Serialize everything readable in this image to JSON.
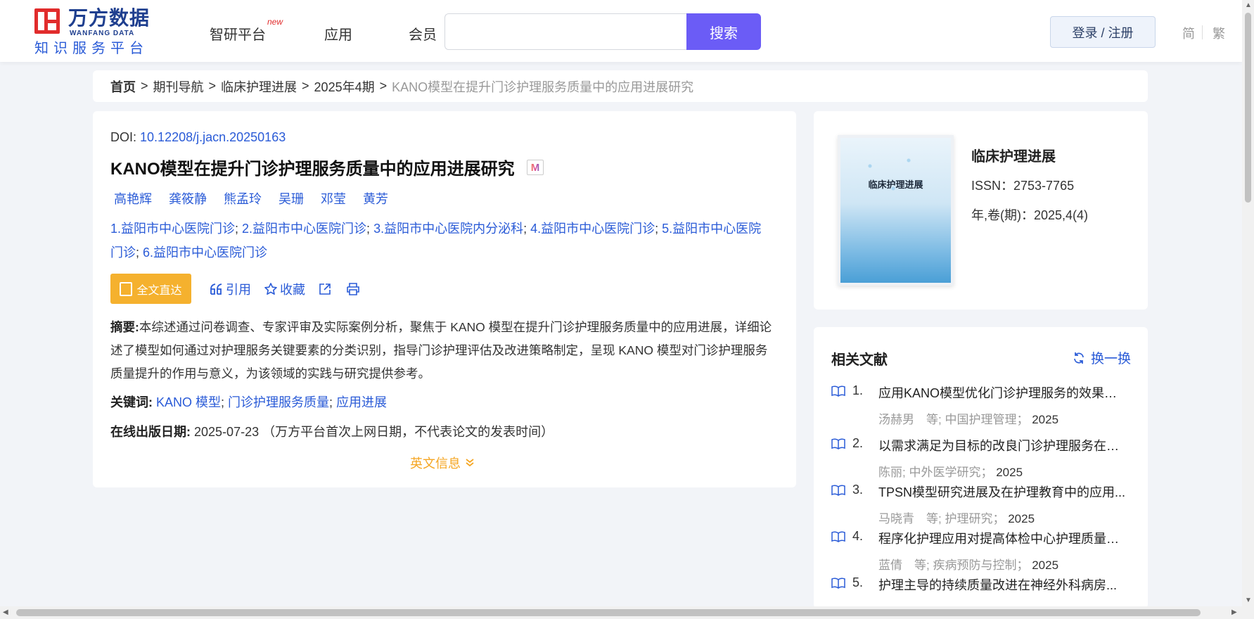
{
  "header": {
    "logo_cn": "万方数据",
    "logo_en": "WANFANG DATA",
    "logo_sub": "知识服务平台",
    "nav": [
      {
        "label": "智研平台",
        "badge": "new"
      },
      {
        "label": "应用"
      },
      {
        "label": "会员"
      }
    ],
    "search_placeholder": "",
    "search_button": "搜索",
    "login_button": "登录 / 注册",
    "lang_simplified": "简",
    "lang_traditional": "繁"
  },
  "breadcrumb": {
    "items": [
      "首页",
      "期刊导航",
      "临床护理进展",
      "2025年4期"
    ],
    "current": "KANO模型在提升门诊护理服务质量中的应用进展研究",
    "separator": ">"
  },
  "article": {
    "doi_label": "DOI:",
    "doi": "10.12208/j.jacn.20250163",
    "title": "KANO模型在提升门诊护理服务质量中的应用进展研究",
    "badge_icon": "M",
    "authors": [
      "高艳辉",
      "龚筱静",
      "熊孟玲",
      "吴珊",
      "邓莹",
      "黄芳"
    ],
    "affiliations": [
      {
        "text": "1.益阳市中心医院门诊"
      },
      {
        "text": "2.益阳市中心医院门诊"
      },
      {
        "text": "3.益阳市中心医院内分泌科"
      },
      {
        "text": "4.益阳市中心医院门诊"
      },
      {
        "text": "5.益阳市中心医院门诊"
      },
      {
        "text": "6.益阳市中心医院门诊"
      }
    ],
    "actions": {
      "fulltext": "全文直达",
      "fulltext_icon_text": "free",
      "cite": "引用",
      "favorite": "收藏"
    },
    "abstract_label": "摘要:",
    "abstract": "本综述通过问卷调查、专家评审及实际案例分析，聚焦于 KANO 模型在提升门诊护理服务质量中的应用进展，详细论述了模型如何通过对护理服务关键要素的分类识别，指导门诊护理评估及改进策略制定，呈现 KANO 模型对门诊护理服务质量提升的作用与意义，为该领域的实践与研究提供参考。",
    "keywords_label": "关键词:",
    "keywords": [
      "KANO 模型",
      "门诊护理服务质量",
      "应用进展"
    ],
    "pubdate_label": "在线出版日期:",
    "pubdate": "2025-07-23",
    "pubdate_note": "（万方平台首次上网日期，不代表论文的发表时间）",
    "en_info": "英文信息"
  },
  "journal": {
    "cover_title": "临床护理进展",
    "name": "临床护理进展",
    "issn": "ISSN：2753-7765",
    "volume": "年,卷(期)：2025,4(4)"
  },
  "related": {
    "title": "相关文献",
    "refresh": "换一换",
    "items": [
      {
        "num": "1.",
        "title": "应用KANO模型优化门诊护理服务的效果研究",
        "authors": "汤赫男　等;",
        "source": "中国护理管理；",
        "year": "2025"
      },
      {
        "num": "2.",
        "title": "以需求满足为目标的改良门诊护理服务在门...",
        "authors": "陈丽;",
        "source": "中外医学研究；",
        "year": "2025"
      },
      {
        "num": "3.",
        "title": "TPSN模型研究进展及在护理教育中的应用...",
        "authors": "马晓青　等;",
        "source": "护理研究；",
        "year": "2025"
      },
      {
        "num": "4.",
        "title": "程序化护理应用对提高体检中心护理质量的...",
        "authors": "蓝倩　等;",
        "source": "疾病预防与控制；",
        "year": "2025"
      },
      {
        "num": "5.",
        "title": "护理主导的持续质量改进在神经外科病房...",
        "authors": "",
        "source": "",
        "year": ""
      }
    ]
  }
}
